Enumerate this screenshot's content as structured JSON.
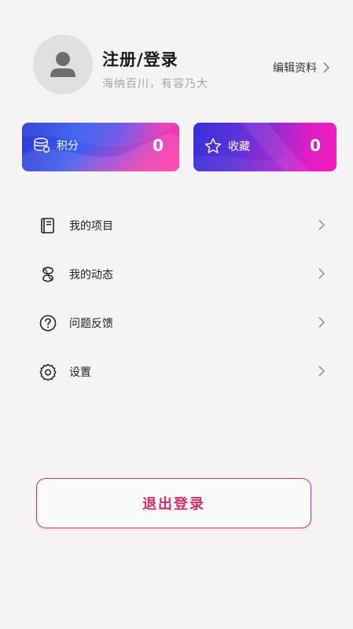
{
  "profile": {
    "title": "注册/登录",
    "subtitle": "海纳百川，有容乃大",
    "edit_label": "编辑资料"
  },
  "cards": {
    "points": {
      "label": "积分",
      "value": "0",
      "icon": "database-icon"
    },
    "favorites": {
      "label": "收藏",
      "value": "0",
      "icon": "star-icon"
    }
  },
  "menu": [
    {
      "label": "我的项目",
      "icon": "notebook-icon"
    },
    {
      "label": "我的动态",
      "icon": "clover-icon"
    },
    {
      "label": "问题反馈",
      "icon": "question-icon"
    },
    {
      "label": "设置",
      "icon": "gear-icon"
    }
  ],
  "logout_label": "退出登录",
  "colors": {
    "background": "#f6f3f5",
    "accent": "#d0306a",
    "card_blue": "#2c3bd8",
    "card_pink": "#ff2fa5"
  }
}
